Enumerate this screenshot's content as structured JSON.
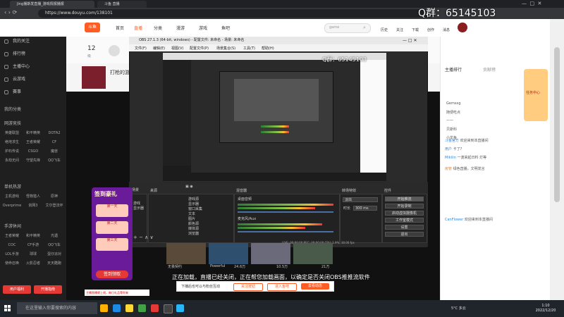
{
  "browser": {
    "tabs": [
      "Jing播斯发直播_游戏情报播报",
      "斗鱼 直播"
    ],
    "url": "https://www.douyu.com/138101"
  },
  "watermark": "Q群：65145103",
  "site_nav": {
    "items": [
      "首页",
      "直播",
      "分类",
      "漫游",
      "游戏",
      "鱼吧"
    ],
    "search_placeholder": "game",
    "right_icons": [
      "历史",
      "关注",
      "下载",
      "创作",
      "消息"
    ],
    "accent": "#ff5d23"
  },
  "sidebar": {
    "items": [
      "我的关注",
      "排行榜",
      "主播中心",
      "云游戏",
      "赛事"
    ],
    "sections": [
      {
        "title": "我的分类",
        "cells": []
      },
      {
        "title": "网游竞技",
        "cells": [
          "英雄联盟",
          "和平精英",
          "DOTA2",
          "绝地求生",
          "王者荣耀",
          "CF",
          "炉石传说",
          "CSGO",
          "魔兽",
          "永劫无间",
          "守望先锋",
          "QQ飞车"
        ]
      },
      {
        "title": "单机热游",
        "cells": [
          "主机游戏",
          "怪物猎人",
          "原神",
          "Overprime",
          "剑网3",
          "艾尔登法环"
        ]
      },
      {
        "title": "手游休闲",
        "cells": [
          "王者荣耀",
          "和平精英",
          "光遇",
          "COC",
          "CF手游",
          "QQ飞车",
          "LOL手游",
          "球球",
          "蛋仔派对",
          "使命召唤",
          "火影忍者",
          "天天酷跑"
        ]
      }
    ],
    "bottom_buttons": [
      "用户福利",
      "开播指南"
    ]
  },
  "room": {
    "level": "12",
    "title": "打枪的游戏",
    "level_label": "级"
  },
  "obs": {
    "window_title": "OBS 27.1.3 (64-bit, windows) - 配置文件: 未命名 - 场景: 未命名",
    "menu": [
      "文件(F)",
      "编辑(E)",
      "视图(V)",
      "配置文件(P)",
      "场景集合(S)",
      "工具(T)",
      "帮助(H)"
    ],
    "inner_watermark": "Q群：65145103",
    "docks": {
      "scenes_title": "场景",
      "scenes": [
        "游戏",
        "显示器"
      ],
      "sources_title": "来源",
      "sources": [
        "游戏源",
        "显示器",
        "窗口采集",
        "文本",
        "图片",
        "颜色源",
        "媒体源",
        "浏览器"
      ],
      "mixer_title": "混音器",
      "mixer": [
        "桌面音频",
        "麦克风/Aux"
      ],
      "transitions_title": "转场特效",
      "transition_value": "淡出",
      "duration_label": "时长",
      "duration_value": "300 ms",
      "controls_title": "控件",
      "controls": [
        "开始推流",
        "开始录制",
        "启动虚拟摄像机",
        "工作室模式",
        "设置",
        "退出"
      ]
    },
    "status": "LIVE: 00:00:00   REC: 00:00:00   CPU: 1.9%, 30.00 fps"
  },
  "thumbs": [
    {
      "title": "无畏契约",
      "viewers": ""
    },
    {
      "title": "Powerful",
      "viewers": "24.6万"
    },
    {
      "title": "",
      "viewers": "10.5万"
    },
    {
      "title": "",
      "viewers": "21万"
    }
  ],
  "overlay_text": "正在加载，直播已经关闭，正在帮您加载画面，以确定是否关闭OBS推推流软件",
  "notice": {
    "text": "下播后也可以与粉丝互动",
    "buttons": [
      "关注按钮",
      "进入鱼吧",
      "去看动态"
    ]
  },
  "promo": {
    "title": "签到豪礼",
    "days": [
      "第一天",
      "第二天",
      "第三天"
    ],
    "cta": "签到领取",
    "banner": "主播直播就上线，每日礼品等你来"
  },
  "right_panel": {
    "tabs": [
      "主播排行",
      "贡献榜"
    ],
    "ranks": [
      "Gemsxg",
      "随便吃点",
      "一一",
      "贝斯科",
      "小龙鱼"
    ],
    "chat": [
      {
        "user": "斗鱼官方",
        "text": "欢迎来到本直播间"
      },
      {
        "user": "用户",
        "text": "卡了?"
      },
      {
        "user": "Mikilin",
        "text": "一波来起日料 灯等"
      },
      {
        "user": "房管",
        "text": "绿色直播，文明发言"
      },
      {
        "user": "CanFlower",
        "text": "欢迎来到本直播间"
      }
    ],
    "side_label": "任务中心"
  },
  "taskbar": {
    "search_placeholder": "在这里输入你要搜索的内容",
    "temperature": "5°C 多云",
    "time": "1:10",
    "date": "2022/12/20"
  }
}
